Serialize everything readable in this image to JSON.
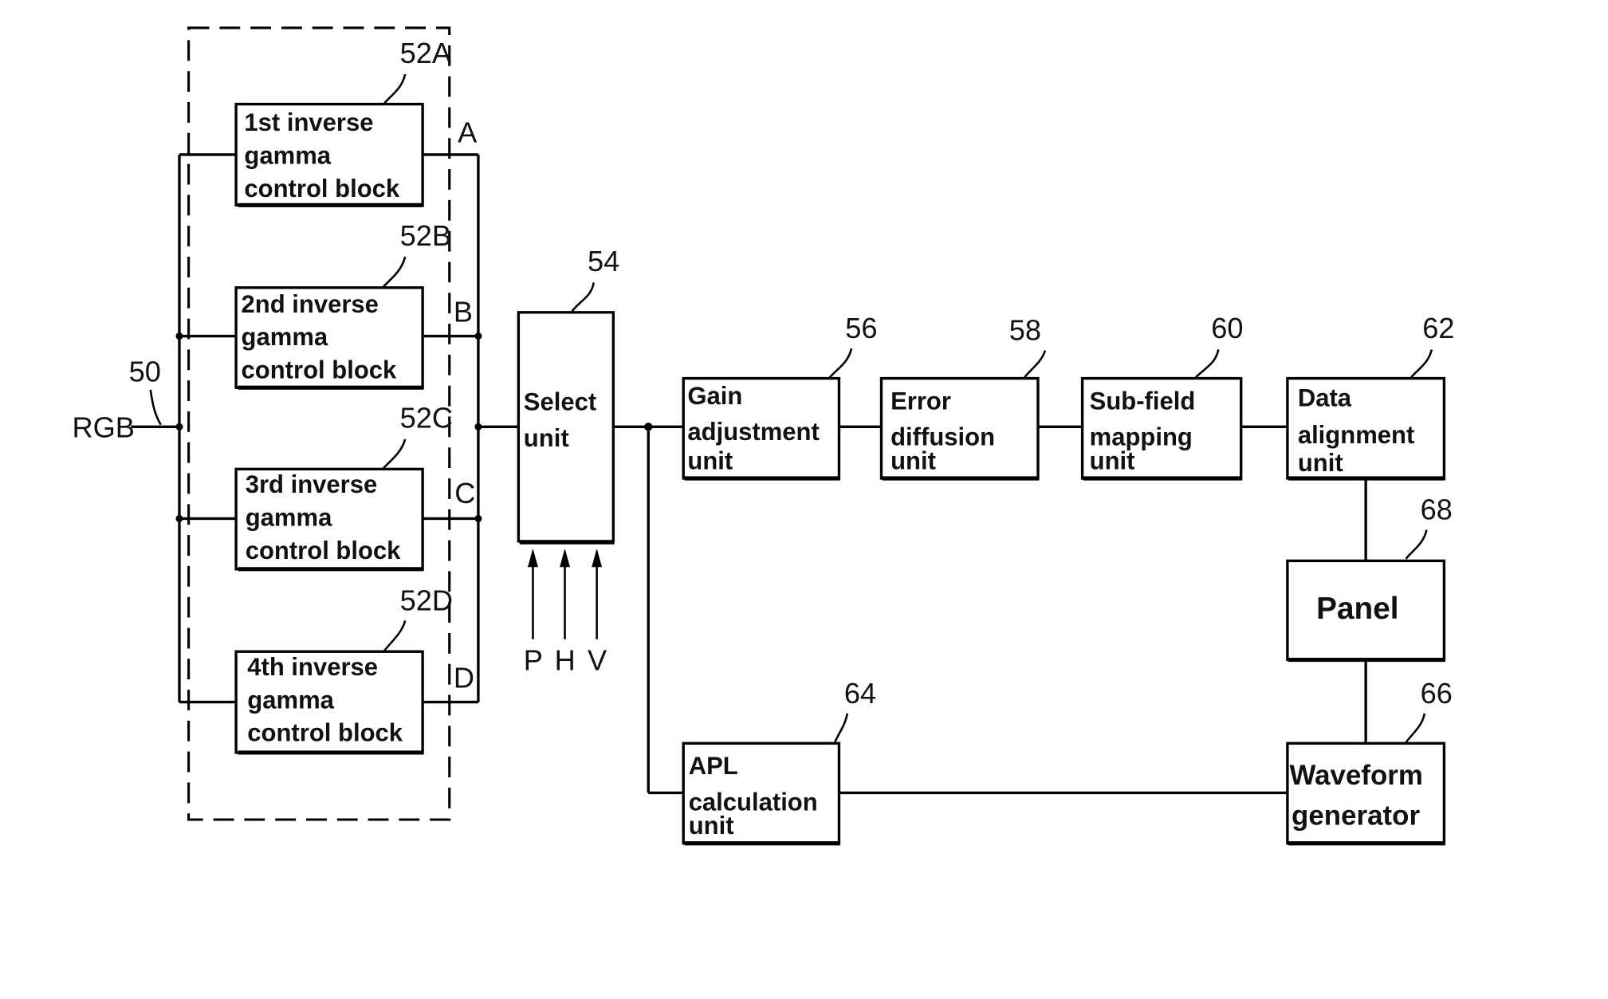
{
  "figure": {
    "input": {
      "label": "RGB",
      "ref": "50"
    },
    "inverse_gamma_group": {
      "blocks": [
        {
          "ref": "52A",
          "lines": [
            "1st inverse",
            "gamma",
            "control block"
          ],
          "port": "A"
        },
        {
          "ref": "52B",
          "lines": [
            "2nd inverse",
            "gamma",
            "control block"
          ],
          "port": "B"
        },
        {
          "ref": "52C",
          "lines": [
            "3rd inverse",
            "gamma",
            "control block"
          ],
          "port": "C"
        },
        {
          "ref": "52D",
          "lines": [
            "4th inverse",
            "gamma",
            "control block"
          ],
          "port": "D"
        }
      ]
    },
    "select_unit": {
      "ref": "54",
      "lines": [
        "Select",
        "unit"
      ],
      "inputs": [
        "P",
        "H",
        "V"
      ]
    },
    "gain_adjustment": {
      "ref": "56",
      "lines": [
        "Gain",
        "adjustment",
        "unit"
      ]
    },
    "error_diffusion": {
      "ref": "58",
      "lines": [
        "Error",
        "diffusion",
        "unit"
      ]
    },
    "subfield_mapping": {
      "ref": "60",
      "lines": [
        "Sub-field",
        "mapping",
        "unit"
      ]
    },
    "data_alignment": {
      "ref": "62",
      "lines": [
        "Data",
        "alignment",
        "unit"
      ]
    },
    "apl_calculation": {
      "ref": "64",
      "lines": [
        "APL",
        "calculation",
        "unit"
      ]
    },
    "waveform_generator": {
      "ref": "66",
      "lines": [
        "Waveform",
        "generator"
      ]
    },
    "panel": {
      "ref": "68",
      "label": "Panel"
    }
  }
}
